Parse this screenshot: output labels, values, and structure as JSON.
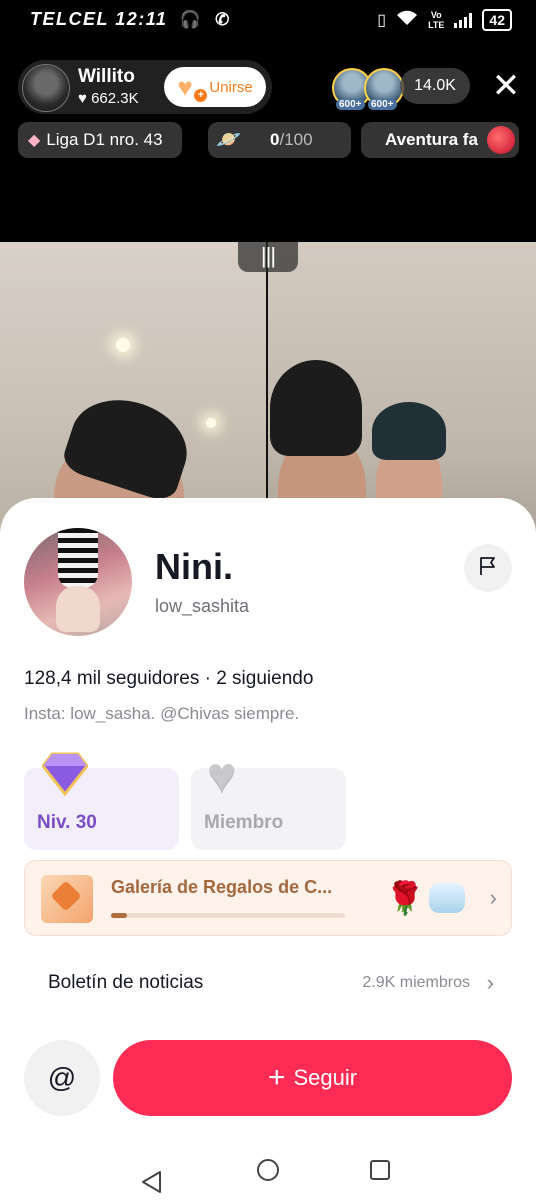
{
  "status_bar": {
    "carrier": "TELCEL",
    "time": "12:11",
    "network_lte_top": "Vo",
    "network_lte_bottom": "LTE",
    "battery": "42"
  },
  "live_header": {
    "host_name": "Willito",
    "host_likes": "662.3K",
    "join_label": "Unirse",
    "viewer_badges": [
      "600+",
      "600+"
    ],
    "viewer_count": "14.0K",
    "league_label": "Liga D1 nro. 43",
    "ring_progress_current": "0",
    "ring_progress_total": "/100",
    "adventure_label": "Aventura fa"
  },
  "profile": {
    "name": "Nini.",
    "handle": "low_sashita",
    "followers_line": "128,4 mil seguidores · 2 siguiendo",
    "bio": "Insta: low_sasha.  @Chivas siempre.",
    "level_label": "Niv. 30",
    "member_label": "Miembro",
    "gallery_title": "Galería de Regalos de C...",
    "gallery_progress": 0.07,
    "newsletter_title": "Boletín de noticias",
    "newsletter_members": "2.9K miembros",
    "mention_symbol": "@",
    "follow_label": "Seguir"
  },
  "colors": {
    "follow_button": "#fe2c55",
    "join_text": "#f27d1e",
    "level_text": "#7c4dc7",
    "gallery_text": "#a3683e"
  },
  "icons": [
    "headphones-icon",
    "whatsapp-icon",
    "wifi-icon",
    "signal-icon",
    "heart-icon",
    "close-icon",
    "gem-icon",
    "planet-icon",
    "flag-icon",
    "chevron-right-icon",
    "rose-icon",
    "plus-icon",
    "back-nav-icon",
    "home-nav-icon",
    "recents-nav-icon"
  ]
}
